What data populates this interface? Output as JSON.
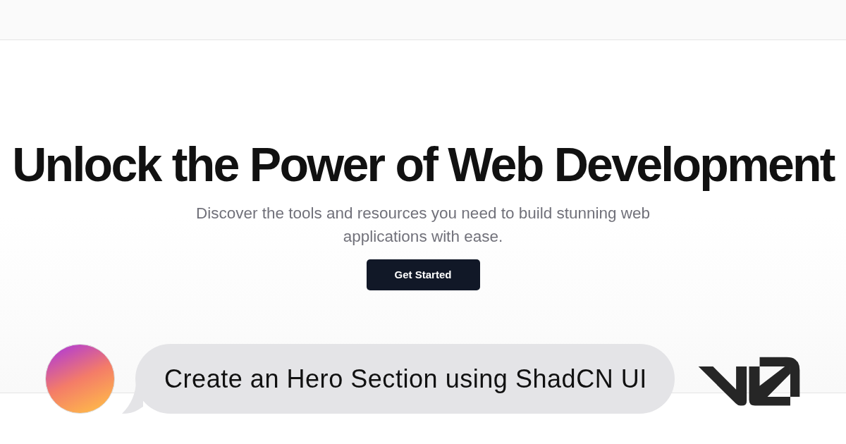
{
  "hero": {
    "heading": "Unlock the Power of Web Development",
    "description": "Discover the tools and resources you need to build stunning web applications with ease.",
    "button": {
      "label": "Get Started"
    }
  },
  "chat": {
    "message": "Create an Hero Section using ShadCN UI"
  }
}
